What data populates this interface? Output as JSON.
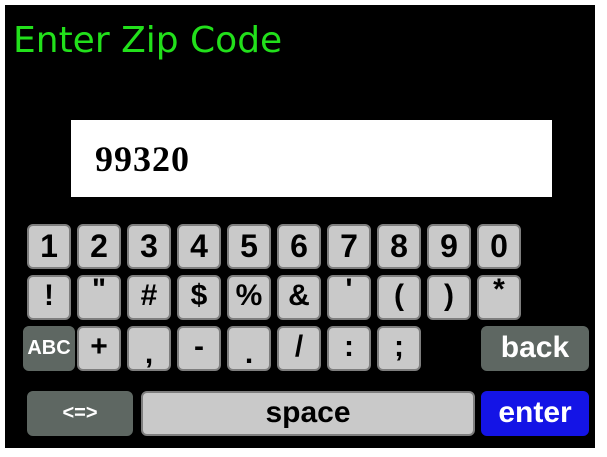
{
  "title": "Enter Zip Code",
  "zip_value": "99320",
  "keyboard": {
    "row1": [
      "1",
      "2",
      "3",
      "4",
      "5",
      "6",
      "7",
      "8",
      "9",
      "0"
    ],
    "row2": [
      "!",
      "\"",
      "#",
      "$",
      "%",
      "&",
      "'",
      "(",
      ")",
      "*"
    ],
    "row3": {
      "abc": "ABC",
      "keys": [
        "+",
        ",",
        "-",
        ".",
        "/",
        ":",
        ";"
      ],
      "back": "back"
    },
    "row4": {
      "switch": "<=>",
      "space": "space",
      "enter": "enter"
    }
  },
  "colors": {
    "title": "#22e01b",
    "key": "#c9c9c9",
    "key_dark": "#5e6762",
    "enter": "#1414e6"
  }
}
